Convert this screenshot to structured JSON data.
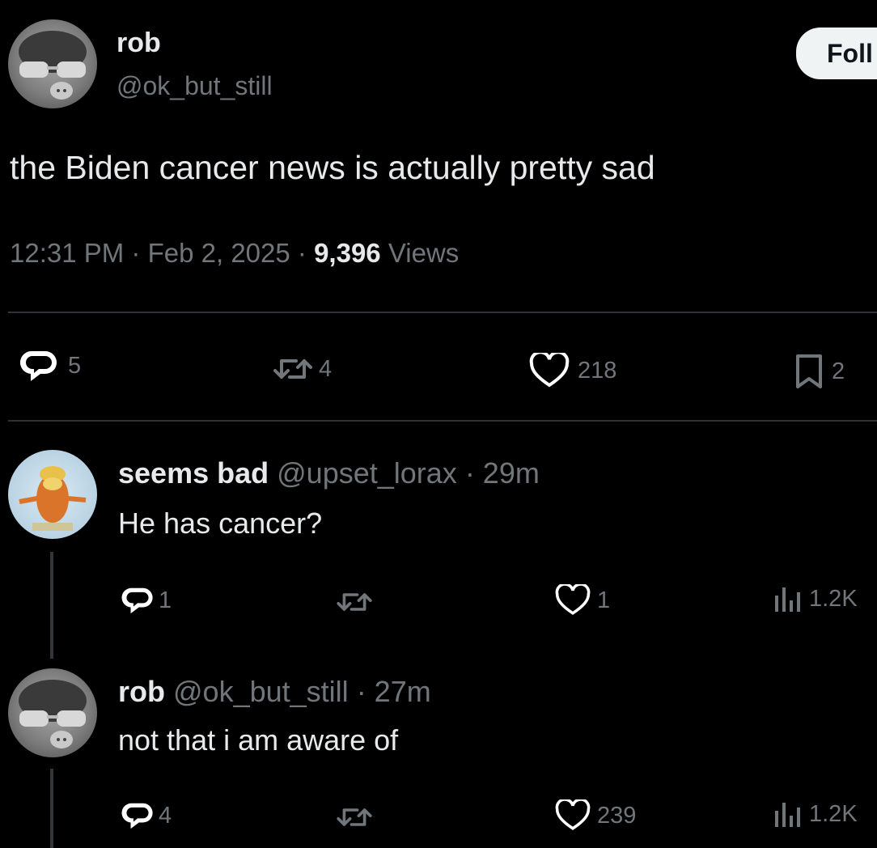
{
  "tweet": {
    "author_name": "rob",
    "author_handle": "@ok_but_still",
    "follow_label": "Foll",
    "text": "the Biden cancer news is actually pretty sad",
    "time": "12:31 PM",
    "date": "Feb 2, 2025",
    "separator": "·",
    "views_count": "9,396",
    "views_label": "Views",
    "replies": "5",
    "reposts": "4",
    "likes": "218",
    "bookmarks": "2"
  },
  "replies": [
    {
      "name": "seems bad",
      "handle": "@upset_lorax",
      "age": "· 29m",
      "text": "He has cancer?",
      "replies": "1",
      "likes": "1",
      "views": "1.2K"
    },
    {
      "name": "rob",
      "handle": "@ok_but_still",
      "age": "· 27m",
      "text": "not that i am aware of",
      "replies": "4",
      "likes": "239",
      "views": "1.2K"
    }
  ],
  "icons": [
    "avatar",
    "reply-icon",
    "repost-icon",
    "like-icon",
    "bookmark-icon",
    "views-icon"
  ]
}
